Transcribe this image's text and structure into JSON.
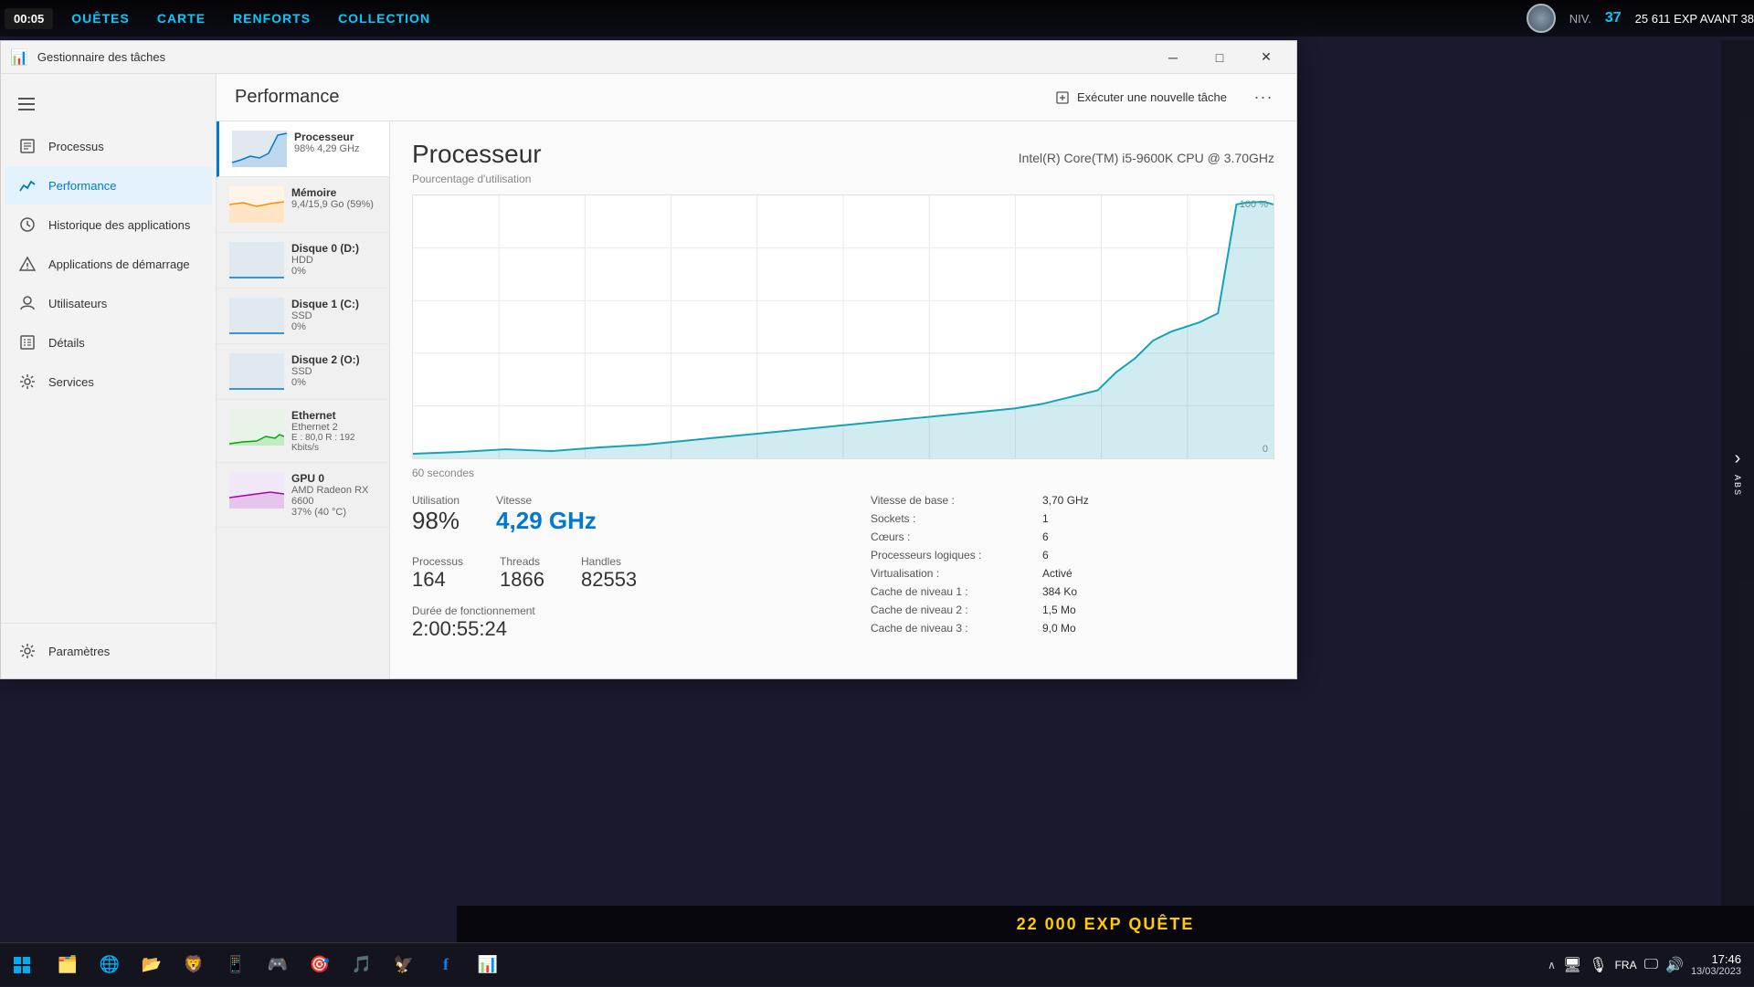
{
  "game": {
    "timer": "00:05",
    "nav": [
      "OUÊTES",
      "CARTE",
      "RENFORTS",
      "COLLECTION"
    ],
    "level_label": "NIV.",
    "level": "37",
    "exp_text": "25 611 EXP AVANT 38",
    "banner_text": "22 000 EXP  QUÊTE"
  },
  "taskmanager": {
    "title": "Gestionnaire des tâches",
    "sidebar": {
      "items": [
        {
          "label": "Processus",
          "icon": "☰"
        },
        {
          "label": "Performance",
          "icon": "📈"
        },
        {
          "label": "Historique des applications",
          "icon": "🕒"
        },
        {
          "label": "Applications de démarrage",
          "icon": "🚀"
        },
        {
          "label": "Utilisateurs",
          "icon": "👤"
        },
        {
          "label": "Détails",
          "icon": "📋"
        },
        {
          "label": "Services",
          "icon": "⚙"
        }
      ],
      "bottom": {
        "label": "Paramètres",
        "icon": "⚙"
      }
    },
    "header": {
      "title": "Performance",
      "new_task_btn": "Exécuter une nouvelle tâche"
    },
    "devices": [
      {
        "name": "Processeur",
        "sub": "98% 4,29 GHz",
        "type": "cpu",
        "pct": 98
      },
      {
        "name": "Mémoire",
        "sub": "9,4/15,9 Go (59%)",
        "type": "mem",
        "pct": 59
      },
      {
        "name": "Disque 0 (D:)",
        "sub2": "HDD",
        "sub": "0%",
        "type": "disk",
        "pct": 0
      },
      {
        "name": "Disque 1 (C:)",
        "sub2": "SSD",
        "sub": "0%",
        "type": "disk",
        "pct": 0
      },
      {
        "name": "Disque 2 (O:)",
        "sub2": "SSD",
        "sub": "0%",
        "type": "disk",
        "pct": 0
      },
      {
        "name": "Ethernet",
        "sub2": "Ethernet 2",
        "sub": "E : 80,0 R : 192 Kbits/s",
        "type": "eth",
        "pct": 20
      },
      {
        "name": "GPU 0",
        "sub2": "AMD Radeon RX 6600",
        "sub": "37% (40 °C)",
        "type": "gpu",
        "pct": 37
      }
    ],
    "panel": {
      "title": "Processeur",
      "cpu_name": "Intel(R) Core(TM) i5-9600K CPU @ 3.70GHz",
      "subtitle": "Pourcentage d'utilisation",
      "duration_label": "60 secondes",
      "chart_100": "100 %",
      "chart_0": "0",
      "stats": {
        "utilisation_label": "Utilisation",
        "utilisation_value": "98%",
        "vitesse_label": "Vitesse",
        "vitesse_value": "4,29 GHz",
        "processus_label": "Processus",
        "processus_value": "164",
        "threads_label": "Threads",
        "threads_value": "1866",
        "handles_label": "Handles",
        "handles_value": "82553",
        "duree_label": "Durée de fonctionnement",
        "duree_value": "2:00:55:24"
      },
      "info": [
        {
          "key": "Vitesse de base :",
          "val": "3,70 GHz"
        },
        {
          "key": "Sockets :",
          "val": "1"
        },
        {
          "key": "Cœurs :",
          "val": "6"
        },
        {
          "key": "Processeurs logiques :",
          "val": "6"
        },
        {
          "key": "Virtualisation :",
          "val": "Activé"
        },
        {
          "key": "Cache de niveau 1 :",
          "val": "384 Ko"
        },
        {
          "key": "Cache de niveau 2 :",
          "val": "1,5 Mo"
        },
        {
          "key": "Cache de niveau 3 :",
          "val": "9,0 Mo"
        }
      ]
    }
  },
  "taskbar": {
    "apps": [
      "⊞",
      "📁",
      "🌐",
      "📂",
      "🦁",
      "📱",
      "🎮",
      "🎯",
      "🎵",
      "🦅",
      "F",
      "📊"
    ],
    "lang": "FRA",
    "time": "17:46",
    "date": "13/03/2023"
  }
}
